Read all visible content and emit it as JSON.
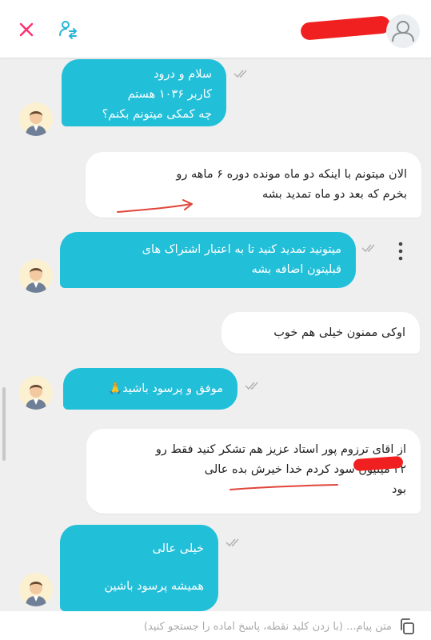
{
  "header": {
    "close_icon": "close-icon",
    "transfer_icon": "user-transfer-icon",
    "avatar_icon": "user-avatar-icon",
    "accent_color": "#ff2d6f",
    "transfer_color": "#26b4d8"
  },
  "messages": [
    {
      "sender": "agent",
      "lines": [
        "سلام و درود",
        "کاربر ۱۰۳۶ هستم",
        "چه کمکی میتونم بکنم؟"
      ]
    },
    {
      "sender": "user",
      "lines": [
        "الان میتونم با اینکه دو ماه مونده دوره ۶ ماهه رو",
        "بخرم که بعد دو ماه تمدید بشه"
      ]
    },
    {
      "sender": "agent",
      "lines": [
        "میتونید تمدید کنید تا به اعتبار اشتراک های",
        "قبلیتون اضافه بشه"
      ]
    },
    {
      "sender": "user",
      "lines": [
        "اوکی ممنون خیلی هم خوب"
      ]
    },
    {
      "sender": "agent",
      "lines": [
        "موفق و پرسود باشید🙏"
      ]
    },
    {
      "sender": "user",
      "lines": [
        "از اقای ترزوم پور استاد عزیز هم تشکر کنید فقط رو",
        "۲۲ میلیون سود کردم خدا خیرش بده عالی",
        "بود"
      ]
    },
    {
      "sender": "agent",
      "lines": [
        "خیلی عالی",
        "همیشه پرسود باشین"
      ]
    }
  ],
  "composer": {
    "placeholder": "متن پیام... (با زدن کلید نقطه، پاسخ آماده را جستجو کنید)"
  },
  "colors": {
    "agent_bubble": "#22bfd9",
    "user_bubble": "#ffffff",
    "background": "#efefef",
    "annotation": "#f02020"
  }
}
